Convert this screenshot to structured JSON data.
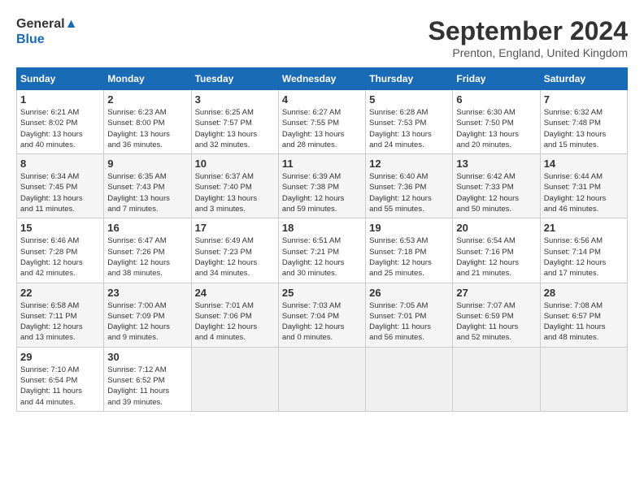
{
  "header": {
    "logo_line1": "General",
    "logo_line2": "Blue",
    "month_title": "September 2024",
    "location": "Prenton, England, United Kingdom"
  },
  "weekdays": [
    "Sunday",
    "Monday",
    "Tuesday",
    "Wednesday",
    "Thursday",
    "Friday",
    "Saturday"
  ],
  "weeks": [
    [
      {
        "day": "1",
        "info": "Sunrise: 6:21 AM\nSunset: 8:02 PM\nDaylight: 13 hours\nand 40 minutes."
      },
      {
        "day": "2",
        "info": "Sunrise: 6:23 AM\nSunset: 8:00 PM\nDaylight: 13 hours\nand 36 minutes."
      },
      {
        "day": "3",
        "info": "Sunrise: 6:25 AM\nSunset: 7:57 PM\nDaylight: 13 hours\nand 32 minutes."
      },
      {
        "day": "4",
        "info": "Sunrise: 6:27 AM\nSunset: 7:55 PM\nDaylight: 13 hours\nand 28 minutes."
      },
      {
        "day": "5",
        "info": "Sunrise: 6:28 AM\nSunset: 7:53 PM\nDaylight: 13 hours\nand 24 minutes."
      },
      {
        "day": "6",
        "info": "Sunrise: 6:30 AM\nSunset: 7:50 PM\nDaylight: 13 hours\nand 20 minutes."
      },
      {
        "day": "7",
        "info": "Sunrise: 6:32 AM\nSunset: 7:48 PM\nDaylight: 13 hours\nand 15 minutes."
      }
    ],
    [
      {
        "day": "8",
        "info": "Sunrise: 6:34 AM\nSunset: 7:45 PM\nDaylight: 13 hours\nand 11 minutes."
      },
      {
        "day": "9",
        "info": "Sunrise: 6:35 AM\nSunset: 7:43 PM\nDaylight: 13 hours\nand 7 minutes."
      },
      {
        "day": "10",
        "info": "Sunrise: 6:37 AM\nSunset: 7:40 PM\nDaylight: 13 hours\nand 3 minutes."
      },
      {
        "day": "11",
        "info": "Sunrise: 6:39 AM\nSunset: 7:38 PM\nDaylight: 12 hours\nand 59 minutes."
      },
      {
        "day": "12",
        "info": "Sunrise: 6:40 AM\nSunset: 7:36 PM\nDaylight: 12 hours\nand 55 minutes."
      },
      {
        "day": "13",
        "info": "Sunrise: 6:42 AM\nSunset: 7:33 PM\nDaylight: 12 hours\nand 50 minutes."
      },
      {
        "day": "14",
        "info": "Sunrise: 6:44 AM\nSunset: 7:31 PM\nDaylight: 12 hours\nand 46 minutes."
      }
    ],
    [
      {
        "day": "15",
        "info": "Sunrise: 6:46 AM\nSunset: 7:28 PM\nDaylight: 12 hours\nand 42 minutes."
      },
      {
        "day": "16",
        "info": "Sunrise: 6:47 AM\nSunset: 7:26 PM\nDaylight: 12 hours\nand 38 minutes."
      },
      {
        "day": "17",
        "info": "Sunrise: 6:49 AM\nSunset: 7:23 PM\nDaylight: 12 hours\nand 34 minutes."
      },
      {
        "day": "18",
        "info": "Sunrise: 6:51 AM\nSunset: 7:21 PM\nDaylight: 12 hours\nand 30 minutes."
      },
      {
        "day": "19",
        "info": "Sunrise: 6:53 AM\nSunset: 7:18 PM\nDaylight: 12 hours\nand 25 minutes."
      },
      {
        "day": "20",
        "info": "Sunrise: 6:54 AM\nSunset: 7:16 PM\nDaylight: 12 hours\nand 21 minutes."
      },
      {
        "day": "21",
        "info": "Sunrise: 6:56 AM\nSunset: 7:14 PM\nDaylight: 12 hours\nand 17 minutes."
      }
    ],
    [
      {
        "day": "22",
        "info": "Sunrise: 6:58 AM\nSunset: 7:11 PM\nDaylight: 12 hours\nand 13 minutes."
      },
      {
        "day": "23",
        "info": "Sunrise: 7:00 AM\nSunset: 7:09 PM\nDaylight: 12 hours\nand 9 minutes."
      },
      {
        "day": "24",
        "info": "Sunrise: 7:01 AM\nSunset: 7:06 PM\nDaylight: 12 hours\nand 4 minutes."
      },
      {
        "day": "25",
        "info": "Sunrise: 7:03 AM\nSunset: 7:04 PM\nDaylight: 12 hours\nand 0 minutes."
      },
      {
        "day": "26",
        "info": "Sunrise: 7:05 AM\nSunset: 7:01 PM\nDaylight: 11 hours\nand 56 minutes."
      },
      {
        "day": "27",
        "info": "Sunrise: 7:07 AM\nSunset: 6:59 PM\nDaylight: 11 hours\nand 52 minutes."
      },
      {
        "day": "28",
        "info": "Sunrise: 7:08 AM\nSunset: 6:57 PM\nDaylight: 11 hours\nand 48 minutes."
      }
    ],
    [
      {
        "day": "29",
        "info": "Sunrise: 7:10 AM\nSunset: 6:54 PM\nDaylight: 11 hours\nand 44 minutes."
      },
      {
        "day": "30",
        "info": "Sunrise: 7:12 AM\nSunset: 6:52 PM\nDaylight: 11 hours\nand 39 minutes."
      },
      {
        "day": "",
        "info": ""
      },
      {
        "day": "",
        "info": ""
      },
      {
        "day": "",
        "info": ""
      },
      {
        "day": "",
        "info": ""
      },
      {
        "day": "",
        "info": ""
      }
    ]
  ]
}
